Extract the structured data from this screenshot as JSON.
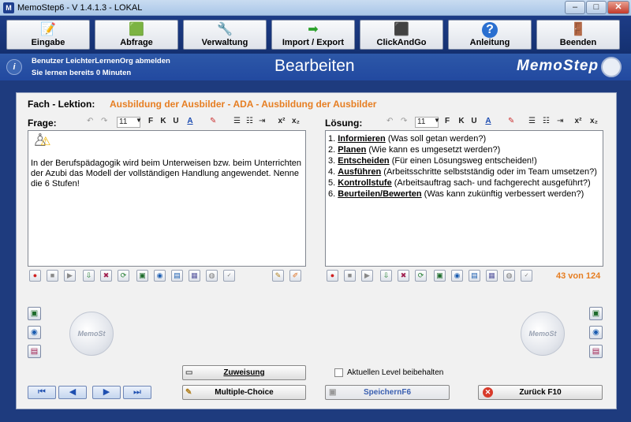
{
  "window": {
    "title": "MemoStep6 - V 1.4.1.3  -  LOKAL",
    "app_icon": "M",
    "minimize": "–",
    "maximize": "□",
    "close": "✕"
  },
  "toolbar": [
    {
      "label": "Eingabe",
      "icon": "📝"
    },
    {
      "label": "Abfrage",
      "icon": "🟩"
    },
    {
      "label": "Verwaltung",
      "icon": "🔧"
    },
    {
      "label": "Import / Export",
      "icon": "➡"
    },
    {
      "label": "ClickAndGo",
      "icon": "⬛"
    },
    {
      "label": "Anleitung",
      "icon": "?"
    },
    {
      "label": "Beenden",
      "icon": "🚪"
    }
  ],
  "header": {
    "user_line": "Benutzer LeichterLernenOrg abmelden",
    "time_line": "Sie lernen bereits 0 Minuten",
    "page_title": "Bearbeiten",
    "logo": "MemoStep",
    "info_icon": "i"
  },
  "lesson": {
    "label": "Fach - Lektion:",
    "value": "Ausbildung der Ausbilder - ADA - Ausbildung der Ausbilder"
  },
  "question": {
    "label": "Frage:",
    "font_size": "11",
    "text": "In der Berufspädagogik wird beim Unterweisen bzw. beim Unterrichten der Azubi das Modell der vollständigen Handlung angewendet. Nenne die 6 Stufen!"
  },
  "answer": {
    "label": "Lösung:",
    "font_size": "11",
    "items": [
      {
        "num": "1.",
        "key": "Informieren",
        "rest": " (Was soll getan werden?)"
      },
      {
        "num": "2.",
        "key": "Planen",
        "rest": " (Wie kann es umgesetzt werden?)"
      },
      {
        "num": "3.",
        "key": "Entscheiden",
        "rest": " (Für einen Lösungsweg entscheiden!)"
      },
      {
        "num": "4.",
        "key": "Ausführen",
        "rest": " (Arbeitsschritte selbstständig oder im Team umsetzen?)"
      },
      {
        "num": "5.",
        "key": "Kontrollstufe",
        "rest": " (Arbeitsauftrag sach- und fachgerecht ausgeführt?)"
      },
      {
        "num": "6.",
        "key": "Beurteilen/Bewerten",
        "rest": " (Was kann zukünftig verbessert werden?)"
      }
    ]
  },
  "format_buttons": {
    "bold": "F",
    "italic": "K",
    "underline": "U",
    "font_color": "A",
    "superscript": "x²",
    "subscript": "x₂"
  },
  "counter": "43 von 124",
  "buttons": {
    "assignment": "Zuweisung",
    "multiple_choice": "Multiple-Choice",
    "save": "SpeichernF6",
    "back": "Zurück  F10"
  },
  "keep_level": {
    "label": "Aktuellen Level beibehalten",
    "checked": false
  },
  "nav": {
    "first": "⏮",
    "prev": "◀",
    "next": "▶",
    "last": "⏭"
  },
  "ring_label": "MemoSt",
  "colors": {
    "accent_orange": "#e67e22",
    "toolbar_blue": "#1d3c86",
    "header_blue": "#2d58a8"
  }
}
